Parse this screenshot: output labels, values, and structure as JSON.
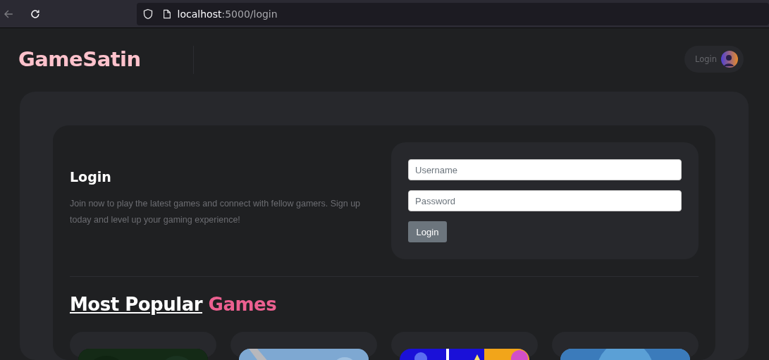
{
  "browser": {
    "back_disabled": true,
    "url_host": "localhost",
    "url_path": ":5000/login"
  },
  "header": {
    "logo": "GameSatin",
    "login_label": "Login"
  },
  "login": {
    "title": "Login",
    "description": "Join now to play the latest games and connect with fellow gamers. Sign up today and level up your gaming experience!",
    "username_placeholder": "Username",
    "password_placeholder": "Password",
    "button": "Login"
  },
  "popular": {
    "title": "Most Popular",
    "highlight": "Games"
  }
}
